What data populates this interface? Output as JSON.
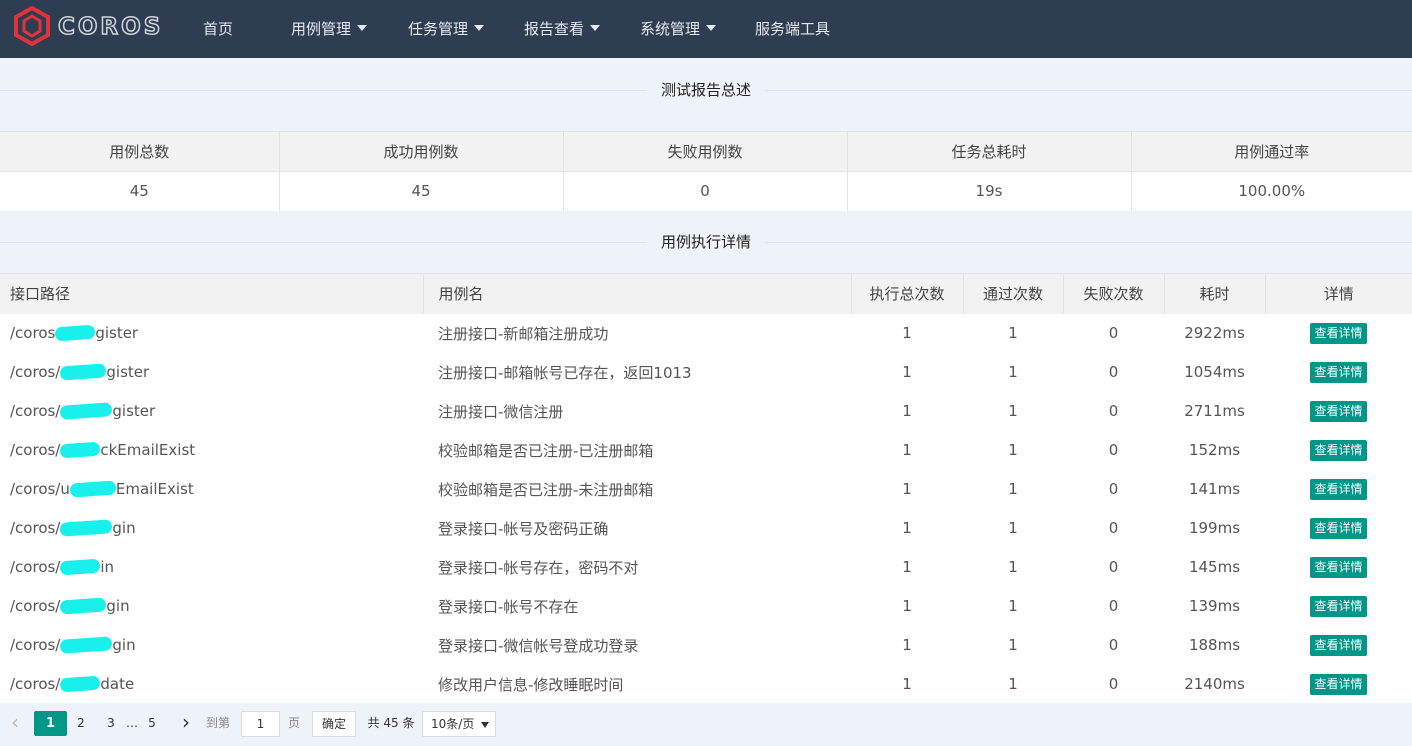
{
  "nav": {
    "logo_text": "COROS",
    "items": [
      {
        "label": "首页",
        "has_caret": false
      },
      {
        "label": "用例管理",
        "has_caret": true
      },
      {
        "label": "任务管理",
        "has_caret": true
      },
      {
        "label": "报告查看",
        "has_caret": true
      },
      {
        "label": "系统管理",
        "has_caret": true
      },
      {
        "label": "服务端工具",
        "has_caret": false
      }
    ]
  },
  "summary": {
    "title": "测试报告总述",
    "headers": [
      "用例总数",
      "成功用例数",
      "失败用例数",
      "任务总耗时",
      "用例通过率"
    ],
    "values": [
      "45",
      "45",
      "0",
      "19s",
      "100.00%"
    ]
  },
  "detail": {
    "title": "用例执行详情",
    "headers": [
      "接口路径",
      "用例名",
      "执行总次数",
      "通过次数",
      "失败次数",
      "耗时",
      "详情"
    ],
    "button_label": "查看详情",
    "rows": [
      {
        "path_start": "/coros",
        "path_end": "gister",
        "name": "注册接口-新邮箱注册成功",
        "total": "1",
        "pass": "1",
        "fail": "0",
        "time": "2922ms"
      },
      {
        "path_start": "/coros/",
        "path_end": "gister",
        "name": "注册接口-邮箱帐号已存在，返回1013",
        "total": "1",
        "pass": "1",
        "fail": "0",
        "time": "1054ms"
      },
      {
        "path_start": "/coros/",
        "path_end": "gister",
        "name": "注册接口-微信注册",
        "total": "1",
        "pass": "1",
        "fail": "0",
        "time": "2711ms"
      },
      {
        "path_start": "/coros/",
        "path_end": "ckEmailExist",
        "name": "校验邮箱是否已注册-已注册邮箱",
        "total": "1",
        "pass": "1",
        "fail": "0",
        "time": "152ms"
      },
      {
        "path_start": "/coros/u",
        "path_end": "EmailExist",
        "name": "校验邮箱是否已注册-未注册邮箱",
        "total": "1",
        "pass": "1",
        "fail": "0",
        "time": "141ms"
      },
      {
        "path_start": "/coros/",
        "path_end": "gin",
        "name": "登录接口-帐号及密码正确",
        "total": "1",
        "pass": "1",
        "fail": "0",
        "time": "199ms"
      },
      {
        "path_start": "/coros/",
        "path_end": "in",
        "name": "登录接口-帐号存在，密码不对",
        "total": "1",
        "pass": "1",
        "fail": "0",
        "time": "145ms"
      },
      {
        "path_start": "/coros/",
        "path_end": "gin",
        "name": "登录接口-帐号不存在",
        "total": "1",
        "pass": "1",
        "fail": "0",
        "time": "139ms"
      },
      {
        "path_start": "/coros/",
        "path_end": "gin",
        "name": "登录接口-微信帐号登成功登录",
        "total": "1",
        "pass": "1",
        "fail": "0",
        "time": "188ms"
      },
      {
        "path_start": "/coros/",
        "path_end": "date",
        "name": "修改用户信息-修改睡眠时间",
        "total": "1",
        "pass": "1",
        "fail": "0",
        "time": "2140ms"
      }
    ]
  },
  "pager": {
    "pages": [
      "1",
      "2",
      "3",
      "…",
      "5"
    ],
    "current": "1",
    "goto_label": "到第",
    "goto_value": "1",
    "page_unit": "页",
    "confirm_label": "确定",
    "total_label": "共 45 条",
    "page_size_label": "10条/页",
    "prev_icon": "‹",
    "next_icon": "›"
  },
  "colors": {
    "nav_bg": "#2f3d52",
    "accent": "#009688",
    "logo_red": "#e0323a",
    "redaction": "#19f0ec"
  }
}
